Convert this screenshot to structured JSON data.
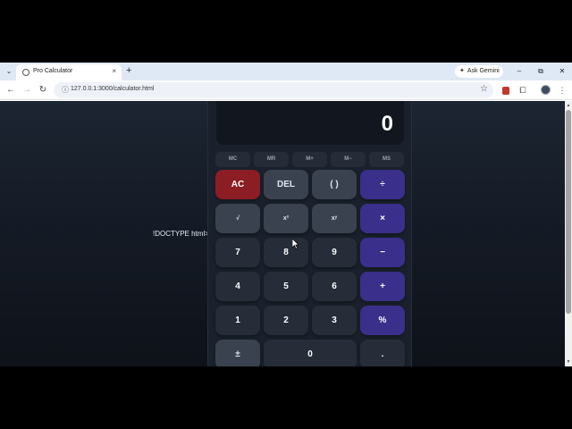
{
  "browser": {
    "tab_list_icon": "chevron-down-icon",
    "tab": {
      "title": "Pro Calculator",
      "close": "×"
    },
    "new_tab": "+",
    "gemini_label": "Ask Gemini",
    "window_controls": {
      "minimize": "–",
      "restore": "⧉",
      "close": "✕"
    },
    "nav": {
      "back": "←",
      "forward": "→",
      "reload": "↻"
    },
    "url": "127.0.0.1:3000/calculator.html",
    "bookmark": "☆"
  },
  "page": {
    "stray_text": "!DOCTYPE html>"
  },
  "calculator": {
    "display": {
      "expression": "0",
      "result": "0"
    },
    "memory": [
      "MC",
      "MR",
      "M+",
      "M−",
      "MS"
    ],
    "keys": {
      "ac": "AC",
      "del": "DEL",
      "parens": "( )",
      "divide": "÷",
      "sqrt": "√",
      "square": "x²",
      "power": "xʸ",
      "multiply": "×",
      "seven": "7",
      "eight": "8",
      "nine": "9",
      "minus": "−",
      "four": "4",
      "five": "5",
      "six": "6",
      "plus": "+",
      "one": "1",
      "two": "2",
      "three": "3",
      "percent": "%",
      "negate": "±",
      "zero": "0",
      "decimal": "."
    },
    "colors": {
      "body": "#1a212c",
      "number_key": "#262d39",
      "function_key": "#3a4250",
      "operator_key": "#3a2f8a",
      "clear_key": "#8c1d24"
    }
  }
}
